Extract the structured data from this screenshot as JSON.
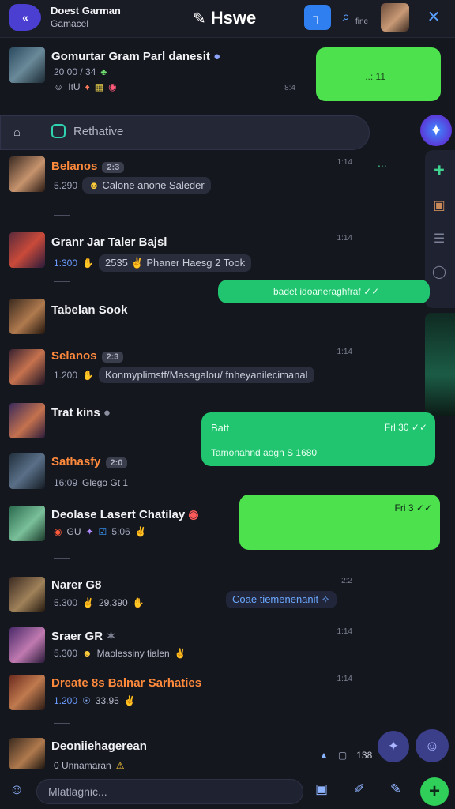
{
  "header": {
    "app_name": "Doest Garman",
    "app_sub": "Gamacel",
    "brand": "Hswe",
    "search_label": "fine"
  },
  "tabs": {
    "label": "Rethative"
  },
  "chats": [
    {
      "name": "Gomurtar Gram Parl danesit",
      "num": "20 00 / 34",
      "meta": "ItU",
      "time": "8:4"
    },
    {
      "name": "Belanos",
      "badge": "2:3",
      "num": "5.290",
      "pill": "Calone anone Saleder",
      "time": "1:14"
    },
    {
      "name": "Granr Jar Taler Bajsl",
      "num": "1:300",
      "pill_num": "2535",
      "pill": "Phaner Haesg 2 Took",
      "time": "1:14"
    },
    {
      "name": "Tabelan Sook"
    },
    {
      "name": "Selanos",
      "badge": "2:3",
      "num": "1.200",
      "pill": "Konmyplimstf/Masagalou/ fnheyanilecimanal",
      "time": "1:14"
    },
    {
      "name": "Trat kins"
    },
    {
      "name": "Sathasfy",
      "badge": "2:0",
      "num": "16:09",
      "meta": "Glego Gt 1"
    },
    {
      "name": "Deolase Lasert Chatilay",
      "meta": "GU",
      "num": "5:06"
    },
    {
      "name": "Narer G8",
      "num": "5.300",
      "pill_num": "29.390",
      "pill": "Coae tiemenenanit",
      "time": "2:2"
    },
    {
      "name": "Sraer GR",
      "num": "5.300",
      "pill": "Maolessiny tialen",
      "time": "1:14"
    },
    {
      "name": "Dreate 8s Balnar Sarhaties",
      "num": "1.200",
      "pill_num": "33.95",
      "time": "1:14"
    },
    {
      "name": "Deoniiehagerean",
      "meta": "0 Unnamaran"
    }
  ],
  "bubbles": [
    {
      "text": "..: 11",
      "kind": "lime"
    },
    {
      "text": "...",
      "kind": "green-dots"
    },
    {
      "text": "badet idoaneraghfraf",
      "ticks": "✓✓",
      "kind": "teal"
    },
    {
      "title": "Batt",
      "body": "Tamonahnd aogn S 1680",
      "time": "Frl 30",
      "ticks": "✓✓",
      "kind": "teal"
    },
    {
      "time": "Fri 3",
      "ticks": "✓✓",
      "kind": "lime"
    }
  ],
  "composer": {
    "placeholder": "Mlatlagnic...",
    "status_count": "138"
  },
  "colors": {
    "background": "#15171f",
    "accent_blue": "#2f7ff0",
    "bubble_lime": "#4ee14e",
    "bubble_teal": "#21c46f",
    "name_orange": "#ff8a3c"
  }
}
